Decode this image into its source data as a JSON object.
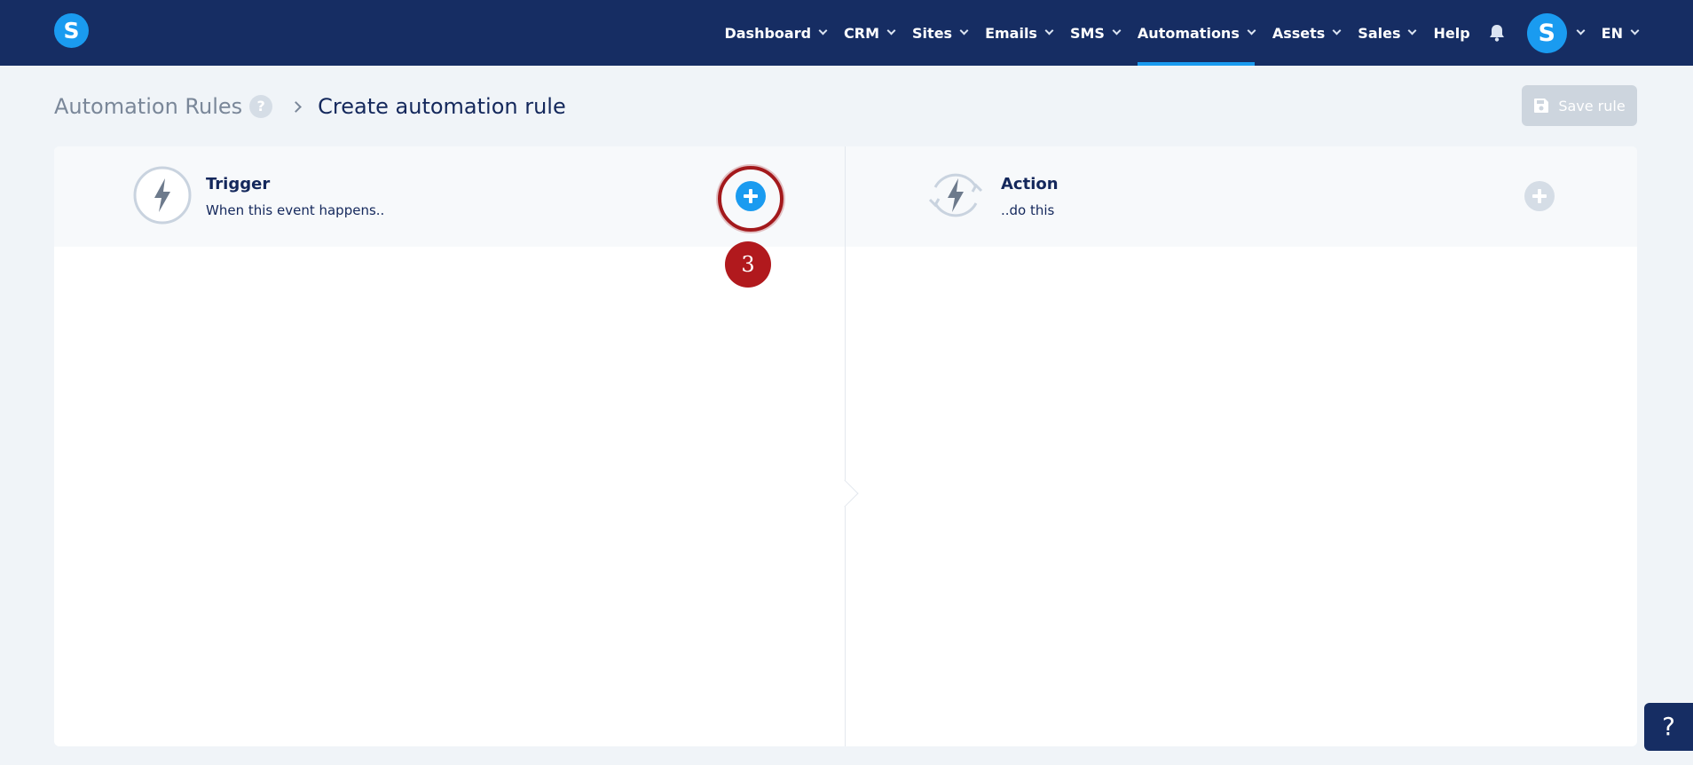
{
  "app": {
    "logo_letter": "S"
  },
  "nav": {
    "items": [
      {
        "label": "Dashboard",
        "has_menu": true
      },
      {
        "label": "CRM",
        "has_menu": true
      },
      {
        "label": "Sites",
        "has_menu": true
      },
      {
        "label": "Emails",
        "has_menu": true
      },
      {
        "label": "SMS",
        "has_menu": true
      },
      {
        "label": "Automations",
        "has_menu": true,
        "active": true
      },
      {
        "label": "Assets",
        "has_menu": true
      },
      {
        "label": "Sales",
        "has_menu": true
      }
    ],
    "help_label": "Help",
    "notifications_icon": "bell-icon",
    "avatar_letter": "S",
    "language": "EN",
    "accent_color": "#1a9bf0",
    "bar_color": "#162d63"
  },
  "header": {
    "breadcrumb_root": "Automation Rules",
    "breadcrumb_help": "?",
    "title": "Create automation rule",
    "save_label": "Save rule",
    "save_enabled": false
  },
  "trigger": {
    "title": "Trigger",
    "subtitle": "When this event happens..",
    "icon": "lightning-icon"
  },
  "action": {
    "title": "Action",
    "subtitle": "..do this",
    "icon": "lightning-cycle-icon"
  },
  "annotation": {
    "step": "3"
  },
  "help_fab": "?"
}
